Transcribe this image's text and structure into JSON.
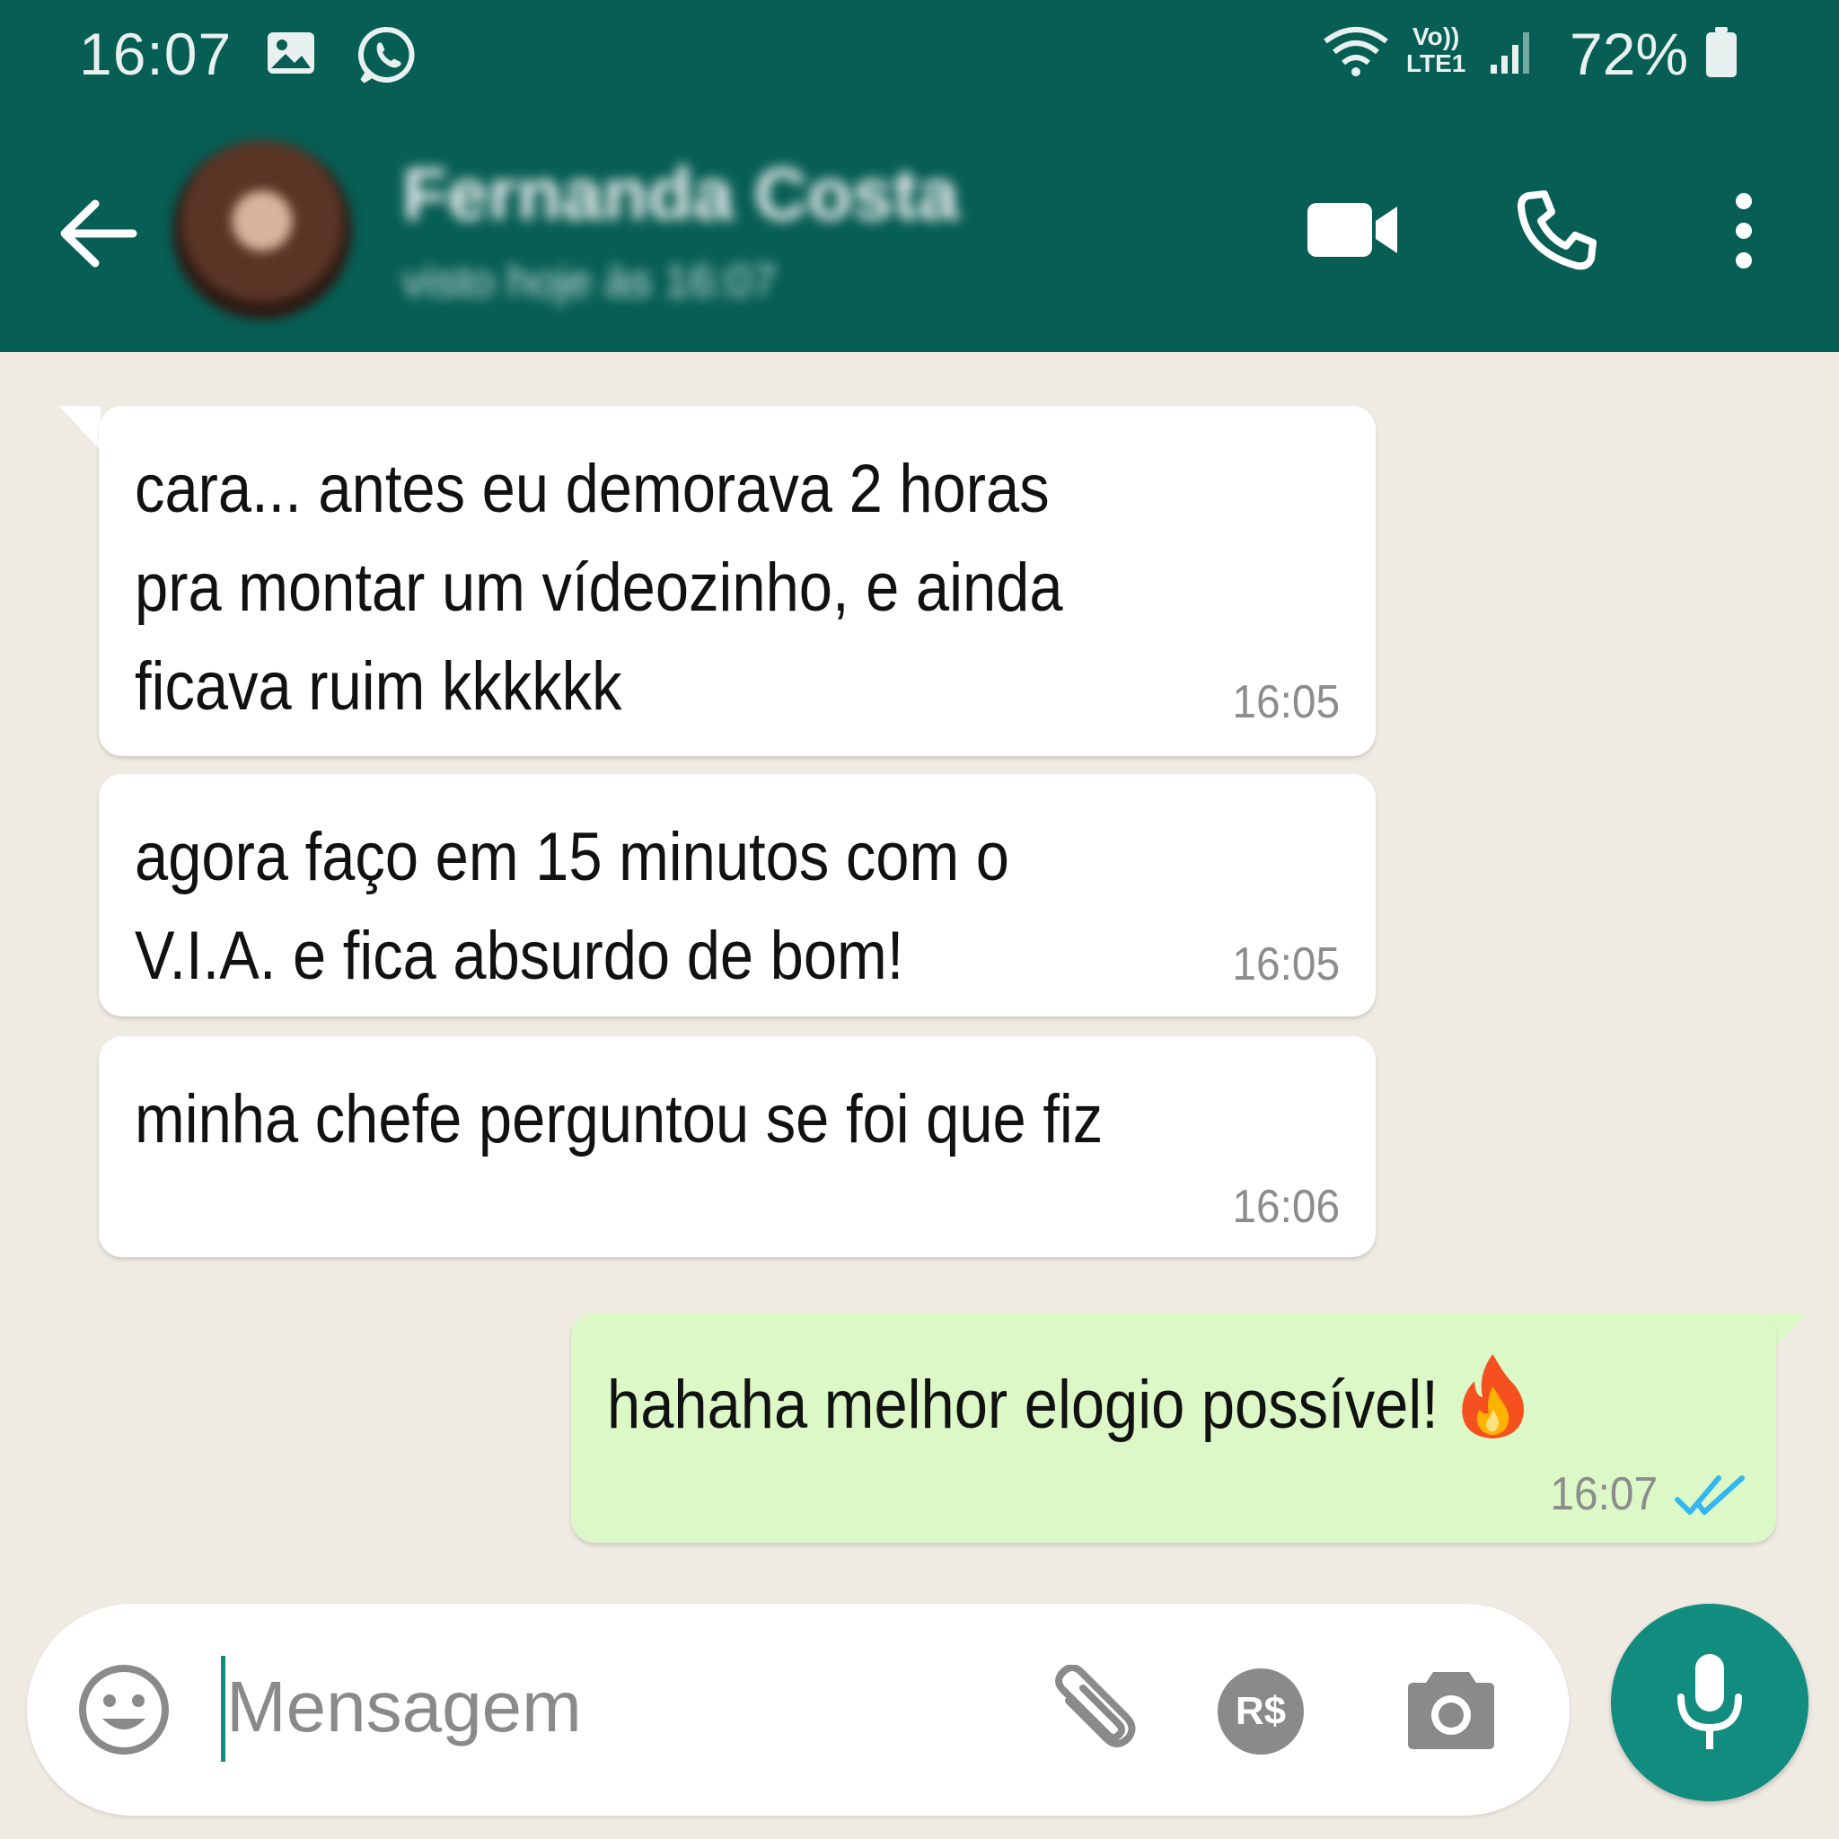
{
  "status_bar": {
    "time": "16:07",
    "network_type_top": "Vo))",
    "network_type_bottom": "LTE1",
    "battery": "72%",
    "icons": [
      "image-icon",
      "whatsapp-icon",
      "wifi-icon",
      "signal-icon",
      "battery-icon"
    ]
  },
  "header": {
    "contact_name": "Fernanda Costa",
    "contact_status": "visto hoje às 16:07",
    "icons": [
      "back-arrow-icon",
      "video-call-icon",
      "phone-call-icon",
      "more-options-icon"
    ]
  },
  "messages": [
    {
      "direction": "incoming",
      "text": "cara... antes eu demorava 2 horas\npra montar um vídeozinho, e ainda\nficava ruim kkkkkk",
      "time": "16:05"
    },
    {
      "direction": "incoming",
      "text": "agora faço em 15 minutos com o\nV.I.A. e fica absurdo de bom!",
      "time": "16:05"
    },
    {
      "direction": "incoming",
      "text": "minha chefe perguntou se foi que fiz",
      "time": "16:06"
    },
    {
      "direction": "outgoing",
      "text": "hahaha melhor elogio possível!",
      "emoji": "fire-icon",
      "time": "16:07",
      "status": "read"
    }
  ],
  "input_bar": {
    "placeholder": "Mensagem",
    "pix_label": "R$",
    "icons": [
      "emoji-icon",
      "attach-icon",
      "pix-icon",
      "camera-icon",
      "microphone-icon"
    ]
  },
  "colors": {
    "header": "#075e54",
    "chat_background": "#efeae2",
    "incoming_bubble": "#ffffff",
    "outgoing_bubble": "#dcf8c6",
    "read_ticks": "#34b7f1",
    "mic_button": "#128c7e"
  }
}
